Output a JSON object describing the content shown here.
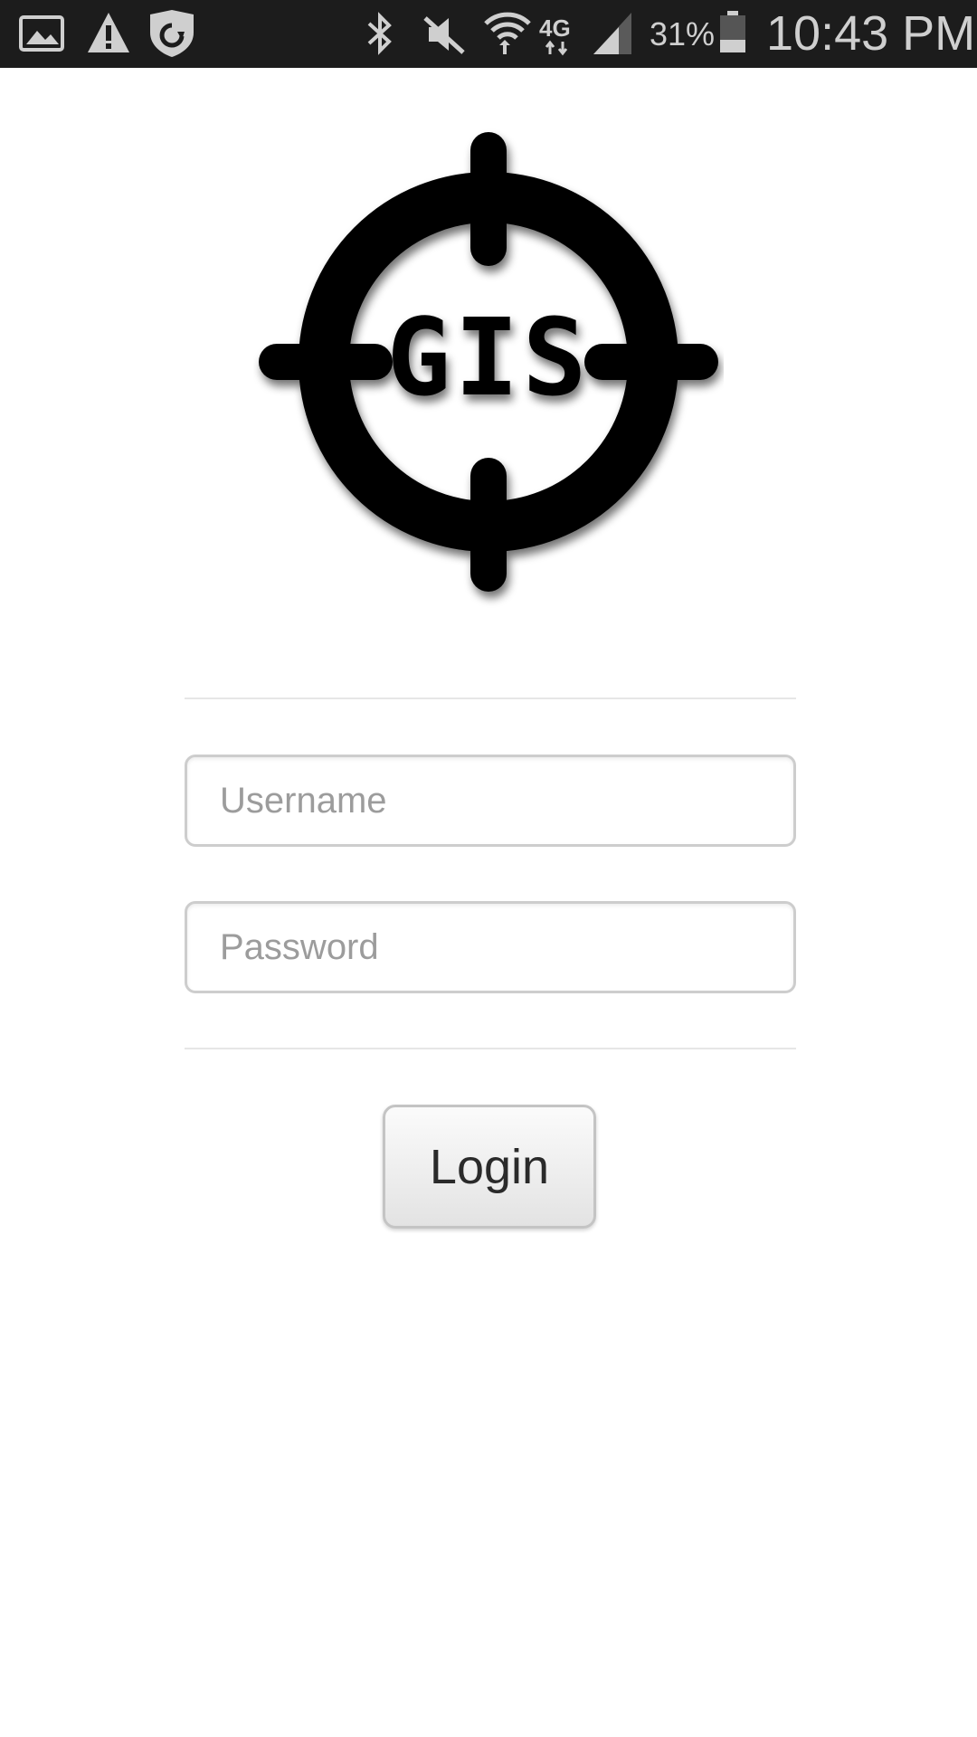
{
  "status_bar": {
    "icons": [
      "gallery-icon",
      "warning-icon",
      "shield-sync-icon",
      "bluetooth-icon",
      "mute-icon",
      "wifi-icon",
      "4g-lte-icon",
      "signal-icon",
      "battery-icon"
    ],
    "network_label": "4G",
    "battery_percent": "31%",
    "time": "10:43 PM"
  },
  "logo": {
    "text": "GIS"
  },
  "form": {
    "username_placeholder": "Username",
    "password_placeholder": "Password",
    "login_label": "Login"
  }
}
